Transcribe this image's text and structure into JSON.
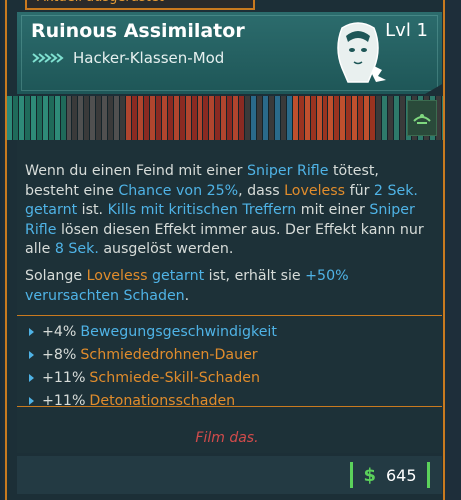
{
  "header": {
    "top_tab": "Aktuell ausgerüstet",
    "title": "Ruinous Assimilator",
    "level": "Lvl 1",
    "subtitle": "Hacker-Klassen-Mod",
    "class_icon": "chevrons-icon",
    "portrait_icon": "hacker-portrait-icon"
  },
  "description": {
    "p1": [
      {
        "t": "Wenn du einen Feind mit einer ",
        "c": ""
      },
      {
        "t": "Sniper Rifle",
        "c": "blue"
      },
      {
        "t": " tötest, besteht eine ",
        "c": ""
      },
      {
        "t": "Chance von 25%",
        "c": "blue"
      },
      {
        "t": ", dass ",
        "c": ""
      },
      {
        "t": "Loveless",
        "c": "orange"
      },
      {
        "t": " für ",
        "c": ""
      },
      {
        "t": "2 Sek. getarnt",
        "c": "blue"
      },
      {
        "t": " ist. ",
        "c": ""
      },
      {
        "t": "Kills mit kritischen Treffern",
        "c": "blue"
      },
      {
        "t": " mit einer ",
        "c": ""
      },
      {
        "t": "Sniper Rifle",
        "c": "blue"
      },
      {
        "t": " lösen diesen Effekt immer aus. Der Effekt kann nur alle ",
        "c": ""
      },
      {
        "t": "8 Sek.",
        "c": "blue"
      },
      {
        "t": " ausgelöst werden.",
        "c": ""
      }
    ],
    "p2": [
      {
        "t": "Solange ",
        "c": ""
      },
      {
        "t": "Loveless",
        "c": "orange"
      },
      {
        "t": " ",
        "c": ""
      },
      {
        "t": "getarnt",
        "c": "blue"
      },
      {
        "t": " ist, erhält sie ",
        "c": ""
      },
      {
        "t": "+50% verursachten Schaden",
        "c": "blue"
      },
      {
        "t": ".",
        "c": ""
      }
    ]
  },
  "stats": [
    {
      "value": "+4%",
      "label": "Bewegungsgeschwindigkeit",
      "color": "blue"
    },
    {
      "value": "+8%",
      "label": "Schmiededrohnen-Dauer",
      "color": "orange"
    },
    {
      "value": "+11%",
      "label": "Schmiede-Skill-Schaden",
      "color": "orange"
    },
    {
      "value": "+11%",
      "label": "Detonationsschaden",
      "color": "orange"
    }
  ],
  "flavor": "Film das.",
  "footer": {
    "currency_icon": "dollar-icon",
    "price": "645"
  },
  "colors": {
    "accent_orange": "#c97a1f",
    "header_teal": "#2c6c6d",
    "price_green": "#5bd15b",
    "text_blue": "#4fb3e6",
    "text_orange": "#e08c2c",
    "flavor_red": "#d24b4b"
  }
}
